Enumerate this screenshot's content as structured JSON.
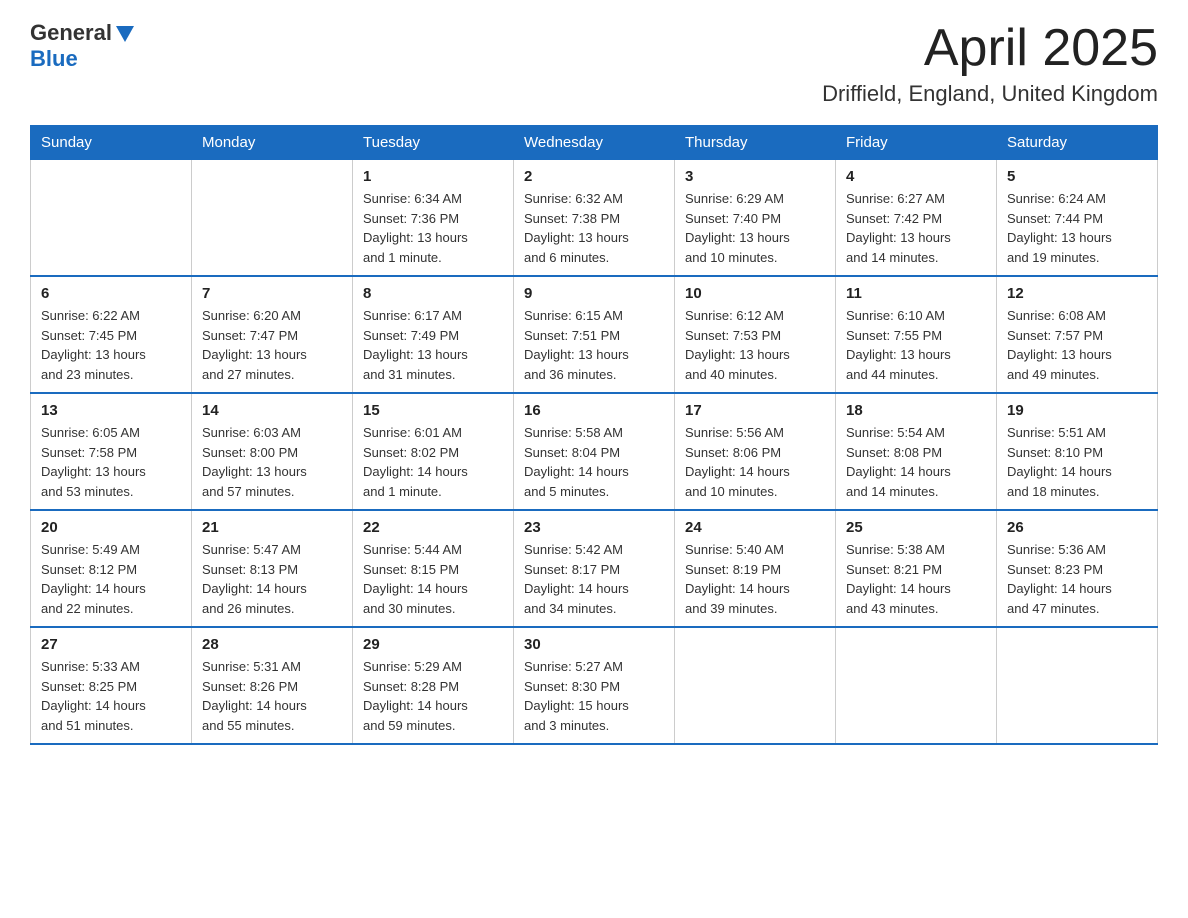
{
  "header": {
    "logo_general": "General",
    "logo_blue": "Blue",
    "title": "April 2025",
    "subtitle": "Driffield, England, United Kingdom"
  },
  "days_of_week": [
    "Sunday",
    "Monday",
    "Tuesday",
    "Wednesday",
    "Thursday",
    "Friday",
    "Saturday"
  ],
  "weeks": [
    [
      {
        "day": "",
        "info": ""
      },
      {
        "day": "",
        "info": ""
      },
      {
        "day": "1",
        "info": "Sunrise: 6:34 AM\nSunset: 7:36 PM\nDaylight: 13 hours\nand 1 minute."
      },
      {
        "day": "2",
        "info": "Sunrise: 6:32 AM\nSunset: 7:38 PM\nDaylight: 13 hours\nand 6 minutes."
      },
      {
        "day": "3",
        "info": "Sunrise: 6:29 AM\nSunset: 7:40 PM\nDaylight: 13 hours\nand 10 minutes."
      },
      {
        "day": "4",
        "info": "Sunrise: 6:27 AM\nSunset: 7:42 PM\nDaylight: 13 hours\nand 14 minutes."
      },
      {
        "day": "5",
        "info": "Sunrise: 6:24 AM\nSunset: 7:44 PM\nDaylight: 13 hours\nand 19 minutes."
      }
    ],
    [
      {
        "day": "6",
        "info": "Sunrise: 6:22 AM\nSunset: 7:45 PM\nDaylight: 13 hours\nand 23 minutes."
      },
      {
        "day": "7",
        "info": "Sunrise: 6:20 AM\nSunset: 7:47 PM\nDaylight: 13 hours\nand 27 minutes."
      },
      {
        "day": "8",
        "info": "Sunrise: 6:17 AM\nSunset: 7:49 PM\nDaylight: 13 hours\nand 31 minutes."
      },
      {
        "day": "9",
        "info": "Sunrise: 6:15 AM\nSunset: 7:51 PM\nDaylight: 13 hours\nand 36 minutes."
      },
      {
        "day": "10",
        "info": "Sunrise: 6:12 AM\nSunset: 7:53 PM\nDaylight: 13 hours\nand 40 minutes."
      },
      {
        "day": "11",
        "info": "Sunrise: 6:10 AM\nSunset: 7:55 PM\nDaylight: 13 hours\nand 44 minutes."
      },
      {
        "day": "12",
        "info": "Sunrise: 6:08 AM\nSunset: 7:57 PM\nDaylight: 13 hours\nand 49 minutes."
      }
    ],
    [
      {
        "day": "13",
        "info": "Sunrise: 6:05 AM\nSunset: 7:58 PM\nDaylight: 13 hours\nand 53 minutes."
      },
      {
        "day": "14",
        "info": "Sunrise: 6:03 AM\nSunset: 8:00 PM\nDaylight: 13 hours\nand 57 minutes."
      },
      {
        "day": "15",
        "info": "Sunrise: 6:01 AM\nSunset: 8:02 PM\nDaylight: 14 hours\nand 1 minute."
      },
      {
        "day": "16",
        "info": "Sunrise: 5:58 AM\nSunset: 8:04 PM\nDaylight: 14 hours\nand 5 minutes."
      },
      {
        "day": "17",
        "info": "Sunrise: 5:56 AM\nSunset: 8:06 PM\nDaylight: 14 hours\nand 10 minutes."
      },
      {
        "day": "18",
        "info": "Sunrise: 5:54 AM\nSunset: 8:08 PM\nDaylight: 14 hours\nand 14 minutes."
      },
      {
        "day": "19",
        "info": "Sunrise: 5:51 AM\nSunset: 8:10 PM\nDaylight: 14 hours\nand 18 minutes."
      }
    ],
    [
      {
        "day": "20",
        "info": "Sunrise: 5:49 AM\nSunset: 8:12 PM\nDaylight: 14 hours\nand 22 minutes."
      },
      {
        "day": "21",
        "info": "Sunrise: 5:47 AM\nSunset: 8:13 PM\nDaylight: 14 hours\nand 26 minutes."
      },
      {
        "day": "22",
        "info": "Sunrise: 5:44 AM\nSunset: 8:15 PM\nDaylight: 14 hours\nand 30 minutes."
      },
      {
        "day": "23",
        "info": "Sunrise: 5:42 AM\nSunset: 8:17 PM\nDaylight: 14 hours\nand 34 minutes."
      },
      {
        "day": "24",
        "info": "Sunrise: 5:40 AM\nSunset: 8:19 PM\nDaylight: 14 hours\nand 39 minutes."
      },
      {
        "day": "25",
        "info": "Sunrise: 5:38 AM\nSunset: 8:21 PM\nDaylight: 14 hours\nand 43 minutes."
      },
      {
        "day": "26",
        "info": "Sunrise: 5:36 AM\nSunset: 8:23 PM\nDaylight: 14 hours\nand 47 minutes."
      }
    ],
    [
      {
        "day": "27",
        "info": "Sunrise: 5:33 AM\nSunset: 8:25 PM\nDaylight: 14 hours\nand 51 minutes."
      },
      {
        "day": "28",
        "info": "Sunrise: 5:31 AM\nSunset: 8:26 PM\nDaylight: 14 hours\nand 55 minutes."
      },
      {
        "day": "29",
        "info": "Sunrise: 5:29 AM\nSunset: 8:28 PM\nDaylight: 14 hours\nand 59 minutes."
      },
      {
        "day": "30",
        "info": "Sunrise: 5:27 AM\nSunset: 8:30 PM\nDaylight: 15 hours\nand 3 minutes."
      },
      {
        "day": "",
        "info": ""
      },
      {
        "day": "",
        "info": ""
      },
      {
        "day": "",
        "info": ""
      }
    ]
  ]
}
